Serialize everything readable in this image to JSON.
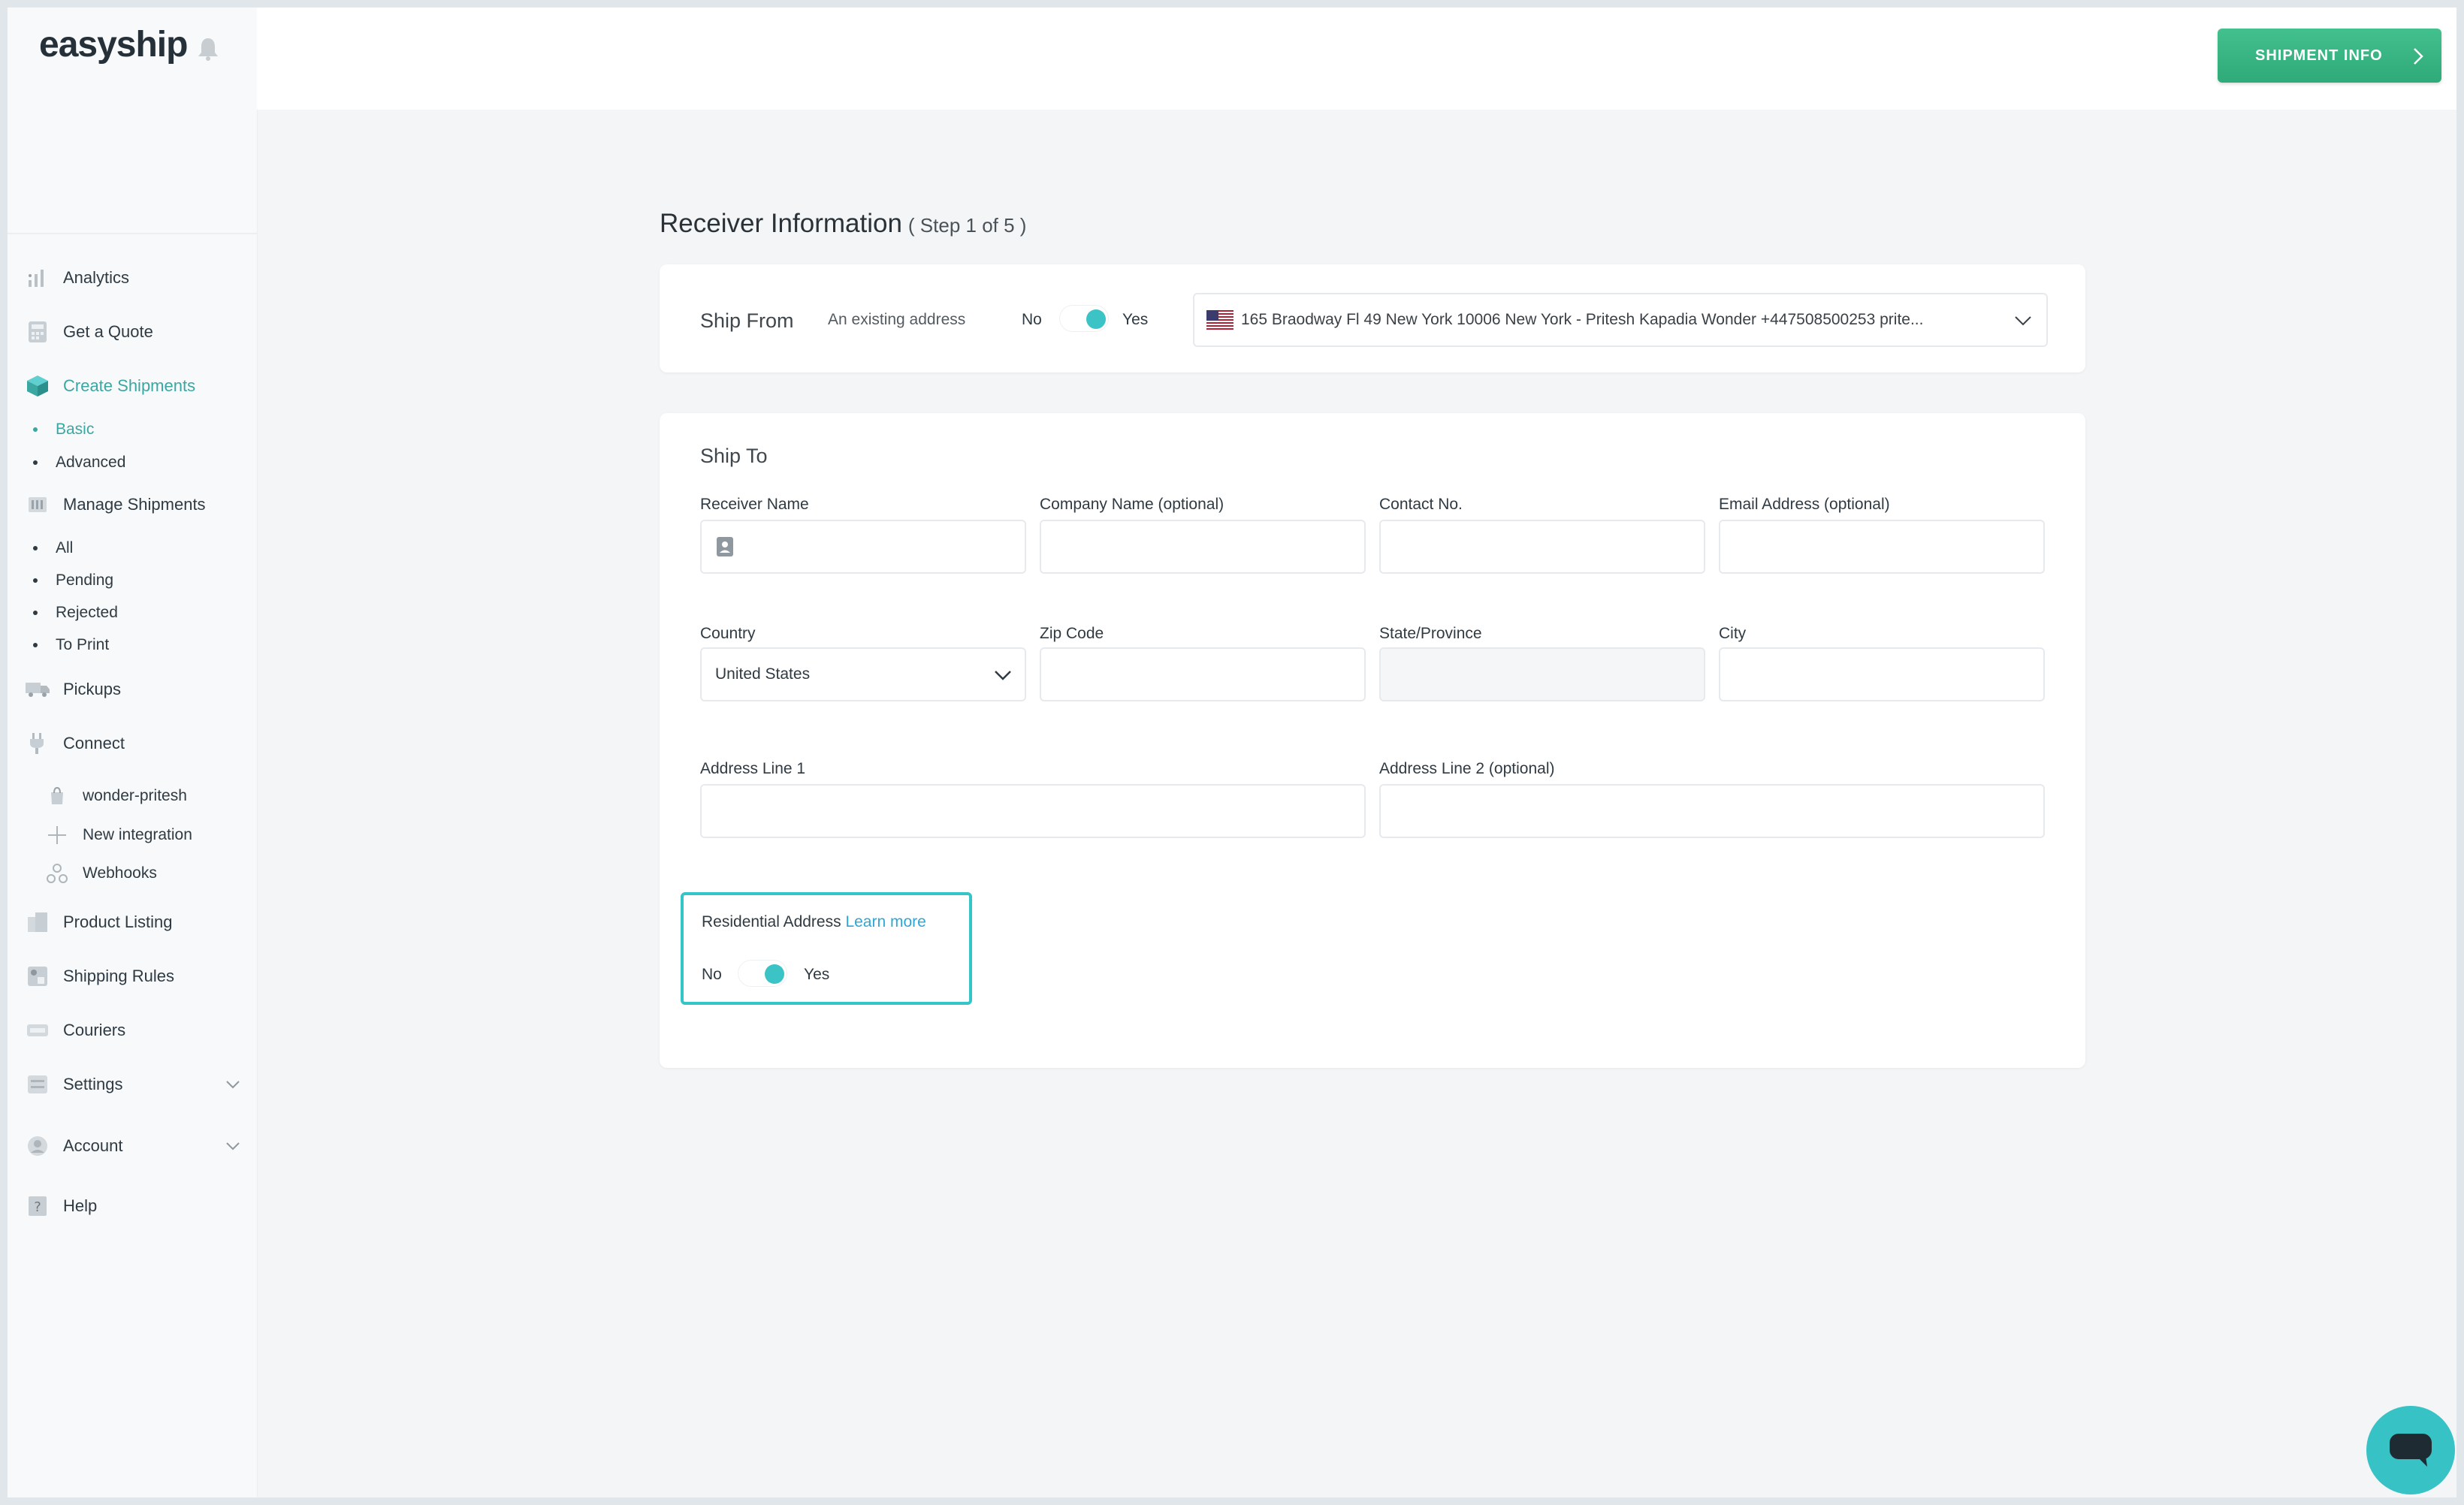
{
  "app": {
    "logo": "easyship"
  },
  "topbar": {
    "shipment_info_label": "SHIPMENT INFO"
  },
  "sidebar": {
    "items": [
      {
        "label": "Analytics",
        "icon": "analytics-icon"
      },
      {
        "label": "Get a Quote",
        "icon": "calculator-icon"
      },
      {
        "label": "Create Shipments",
        "icon": "box-icon",
        "active": true
      },
      {
        "label": "Manage Shipments",
        "icon": "list-icon"
      },
      {
        "label": "Pickups",
        "icon": "truck-icon"
      },
      {
        "label": "Connect",
        "icon": "plug-icon"
      },
      {
        "label": "Product Listing",
        "icon": "products-icon"
      },
      {
        "label": "Shipping Rules",
        "icon": "rules-icon"
      },
      {
        "label": "Couriers",
        "icon": "courier-icon"
      },
      {
        "label": "Settings",
        "icon": "settings-icon"
      },
      {
        "label": "Account",
        "icon": "account-icon"
      },
      {
        "label": "Help",
        "icon": "help-icon"
      }
    ],
    "create_sub": [
      {
        "label": "Basic",
        "active": true
      },
      {
        "label": "Advanced"
      }
    ],
    "manage_sub": [
      {
        "label": "All"
      },
      {
        "label": "Pending"
      },
      {
        "label": "Rejected"
      },
      {
        "label": "To Print"
      }
    ],
    "connect_sub": [
      {
        "label": "wonder-pritesh",
        "icon": "store-icon"
      },
      {
        "label": "New integration",
        "icon": "plus-icon"
      },
      {
        "label": "Webhooks",
        "icon": "webhooks-icon"
      }
    ]
  },
  "main": {
    "title": "Receiver Information",
    "step": "( Step 1 of 5 )",
    "ship_from": {
      "label": "Ship From",
      "existing_label": "An existing address",
      "no": "No",
      "yes": "Yes",
      "toggle_on": true,
      "address": "165 Braodway Fl 49 New York 10006 New York - Pritesh Kapadia Wonder +447508500253 prite..."
    },
    "ship_to": {
      "title": "Ship To",
      "labels": {
        "receiver_name": "Receiver Name",
        "company_name": "Company Name (optional)",
        "contact_no": "Contact No.",
        "email": "Email Address (optional)",
        "country": "Country",
        "zip": "Zip Code",
        "state": "State/Province",
        "city": "City",
        "address1": "Address Line 1",
        "address2": "Address Line 2 (optional)"
      },
      "values": {
        "receiver_name": "",
        "company_name": "",
        "contact_no": "",
        "email": "",
        "country": "United States",
        "zip": "",
        "state": "",
        "city": "",
        "address1": "",
        "address2": ""
      },
      "residential": {
        "label": "Residential Address",
        "link": "Learn more",
        "no": "No",
        "yes": "Yes",
        "toggle_on": true
      }
    }
  },
  "colors": {
    "accent": "#3aa7a3",
    "toggle": "#3cc3c6",
    "button": "#35b582",
    "highlight": "#35c4c8",
    "link": "#2ea6d6"
  }
}
